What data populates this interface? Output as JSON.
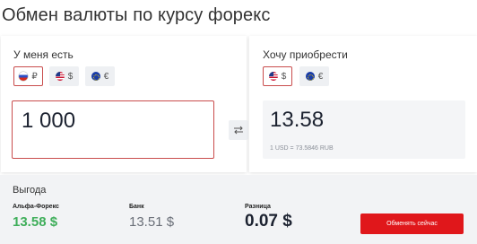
{
  "title": "Обмен валюты по курсу форекс",
  "have": {
    "label": "У меня есть",
    "currencies": [
      {
        "flag": "ru-flag",
        "symbol": "₽",
        "active": true
      },
      {
        "flag": "us-flag",
        "symbol": "$",
        "active": false
      },
      {
        "flag": "eu-flag",
        "symbol": "€",
        "active": false
      }
    ],
    "amount": "1 000"
  },
  "want": {
    "label": "Хочу приобрести",
    "currencies": [
      {
        "flag": "us-flag",
        "symbol": "$",
        "active": true
      },
      {
        "flag": "eu-flag",
        "symbol": "€",
        "active": false
      }
    ],
    "amount": "13.58",
    "rate": "1 USD = 73.5846 RUB"
  },
  "benefit": {
    "label": "Выгода",
    "alfa_label": "Альфа-Форекс",
    "alfa_value": "13.58 $",
    "bank_label": "Банк",
    "bank_value": "13.51 $",
    "diff_label": "Разница",
    "diff_value": "0.07 $",
    "button": "Обменять сейчас"
  },
  "colors": {
    "accent": "#e0171b",
    "active_border": "#c94c4c",
    "positive": "#3fae5a"
  }
}
